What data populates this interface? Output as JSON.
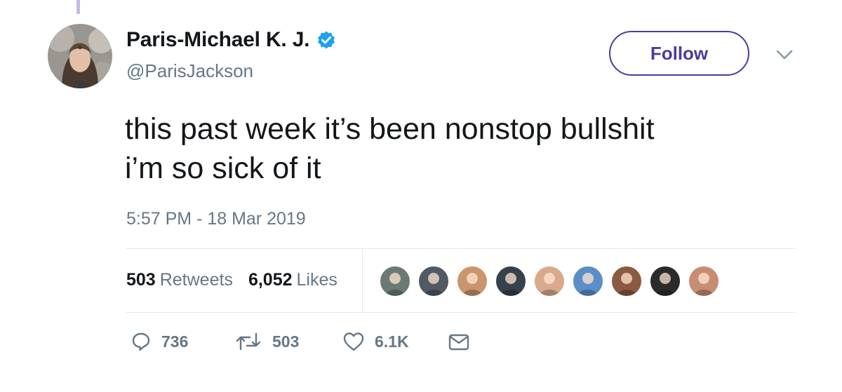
{
  "author": {
    "display_name": "Paris-Michael K. J.",
    "handle": "@ParisJackson",
    "verified": true,
    "avatar_icon": "profile-photo"
  },
  "header": {
    "follow_label": "Follow",
    "menu_icon": "chevron-down-icon"
  },
  "tweet": {
    "text_lines": [
      "this past week it’s been nonstop bullshit",
      "i’m so sick of it"
    ],
    "timestamp": "5:57 PM - 18 Mar 2019"
  },
  "stats": {
    "retweets_count": "503",
    "retweets_label": "Retweets",
    "likes_count": "6,052",
    "likes_label": "Likes"
  },
  "likers": [
    {
      "name": "liker-avatar-1",
      "color": "#6b7a73"
    },
    {
      "name": "liker-avatar-2",
      "color": "#4f5a63"
    },
    {
      "name": "liker-avatar-3",
      "color": "#c9956d"
    },
    {
      "name": "liker-avatar-4",
      "color": "#37404d"
    },
    {
      "name": "liker-avatar-5",
      "color": "#d9a98c"
    },
    {
      "name": "liker-avatar-6",
      "color": "#5b8ec6"
    },
    {
      "name": "liker-avatar-7",
      "color": "#8a5a42"
    },
    {
      "name": "liker-avatar-8",
      "color": "#2b2b2b"
    },
    {
      "name": "liker-avatar-9",
      "color": "#c78d72"
    }
  ],
  "actions": {
    "reply_count": "736",
    "retweet_count": "503",
    "like_count": "6.1K"
  },
  "colors": {
    "accent": "#4b3c9b",
    "verified": "#1da1f2",
    "secondary_text": "#657786",
    "divider": "#e1e8ed",
    "thread_line": "#c6b9e6"
  }
}
